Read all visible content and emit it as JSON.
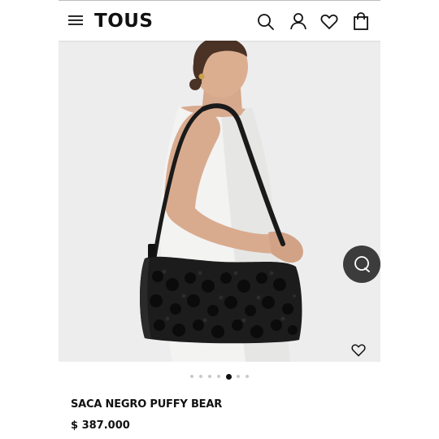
{
  "header": {
    "logo": "TOUS",
    "icons": [
      "menu-icon",
      "search-icon",
      "account-icon",
      "heart-icon",
      "bag-icon"
    ]
  },
  "gallery": {
    "image_count": 7,
    "active_index": 4
  },
  "product": {
    "name": "SACA NEGRO PUFFY BEAR",
    "price": "$ 387.000"
  },
  "colors": {
    "text": "#111111",
    "image_bg": "#ededee",
    "chat_bg": "#3c3c3c",
    "dot_inactive": "#c9c9c9"
  }
}
